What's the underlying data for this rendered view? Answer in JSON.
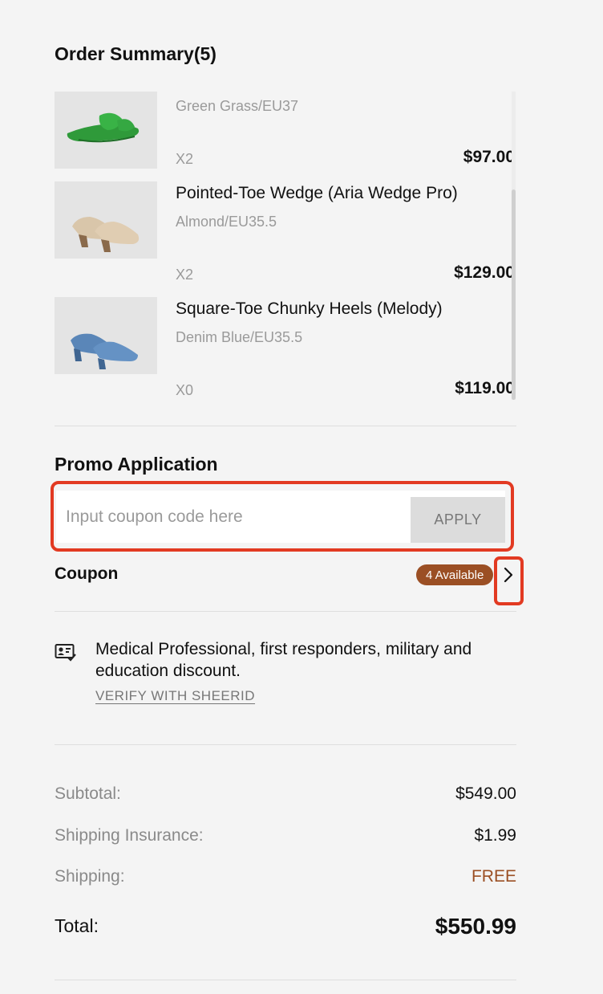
{
  "order_summary": {
    "title": "Order Summary(5)",
    "items": [
      {
        "name": "",
        "variant": "Green Grass/EU37",
        "qty": "X2",
        "price": "$97.00",
        "image": "green-bow-flat-shoe"
      },
      {
        "name": "Pointed-Toe Wedge (Aria Wedge Pro)",
        "variant": "Almond/EU35.5",
        "qty": "X2",
        "price": "$129.00",
        "image": "almond-wedge-shoe"
      },
      {
        "name": "Square-Toe Chunky Heels (Melody)",
        "variant": "Denim Blue/EU35.5",
        "qty": "X0",
        "price": "$119.00",
        "image": "denim-blue-heel-shoe"
      }
    ]
  },
  "promo": {
    "title": "Promo Application",
    "placeholder": "Input coupon code here",
    "input_value": "",
    "apply_label": "APPLY",
    "coupon_label": "Coupon",
    "available_badge": "4 Available",
    "chevron_icon": "chevron-right-icon",
    "highlight_color": "#e23a22",
    "badge_color": "#9b4f24"
  },
  "sheerid": {
    "icon": "id-card-check-icon",
    "text": "Medical Professional, first responders, military and education discount.",
    "link_label": "VERIFY WITH SHEERID"
  },
  "totals": {
    "subtotal_label": "Subtotal:",
    "subtotal_value": "$549.00",
    "insurance_label": "Shipping Insurance:",
    "insurance_value": "$1.99",
    "shipping_label": "Shipping:",
    "shipping_value": "FREE",
    "shipping_value_color": "#9b4f24",
    "total_label": "Total:",
    "total_value": "$550.99"
  }
}
